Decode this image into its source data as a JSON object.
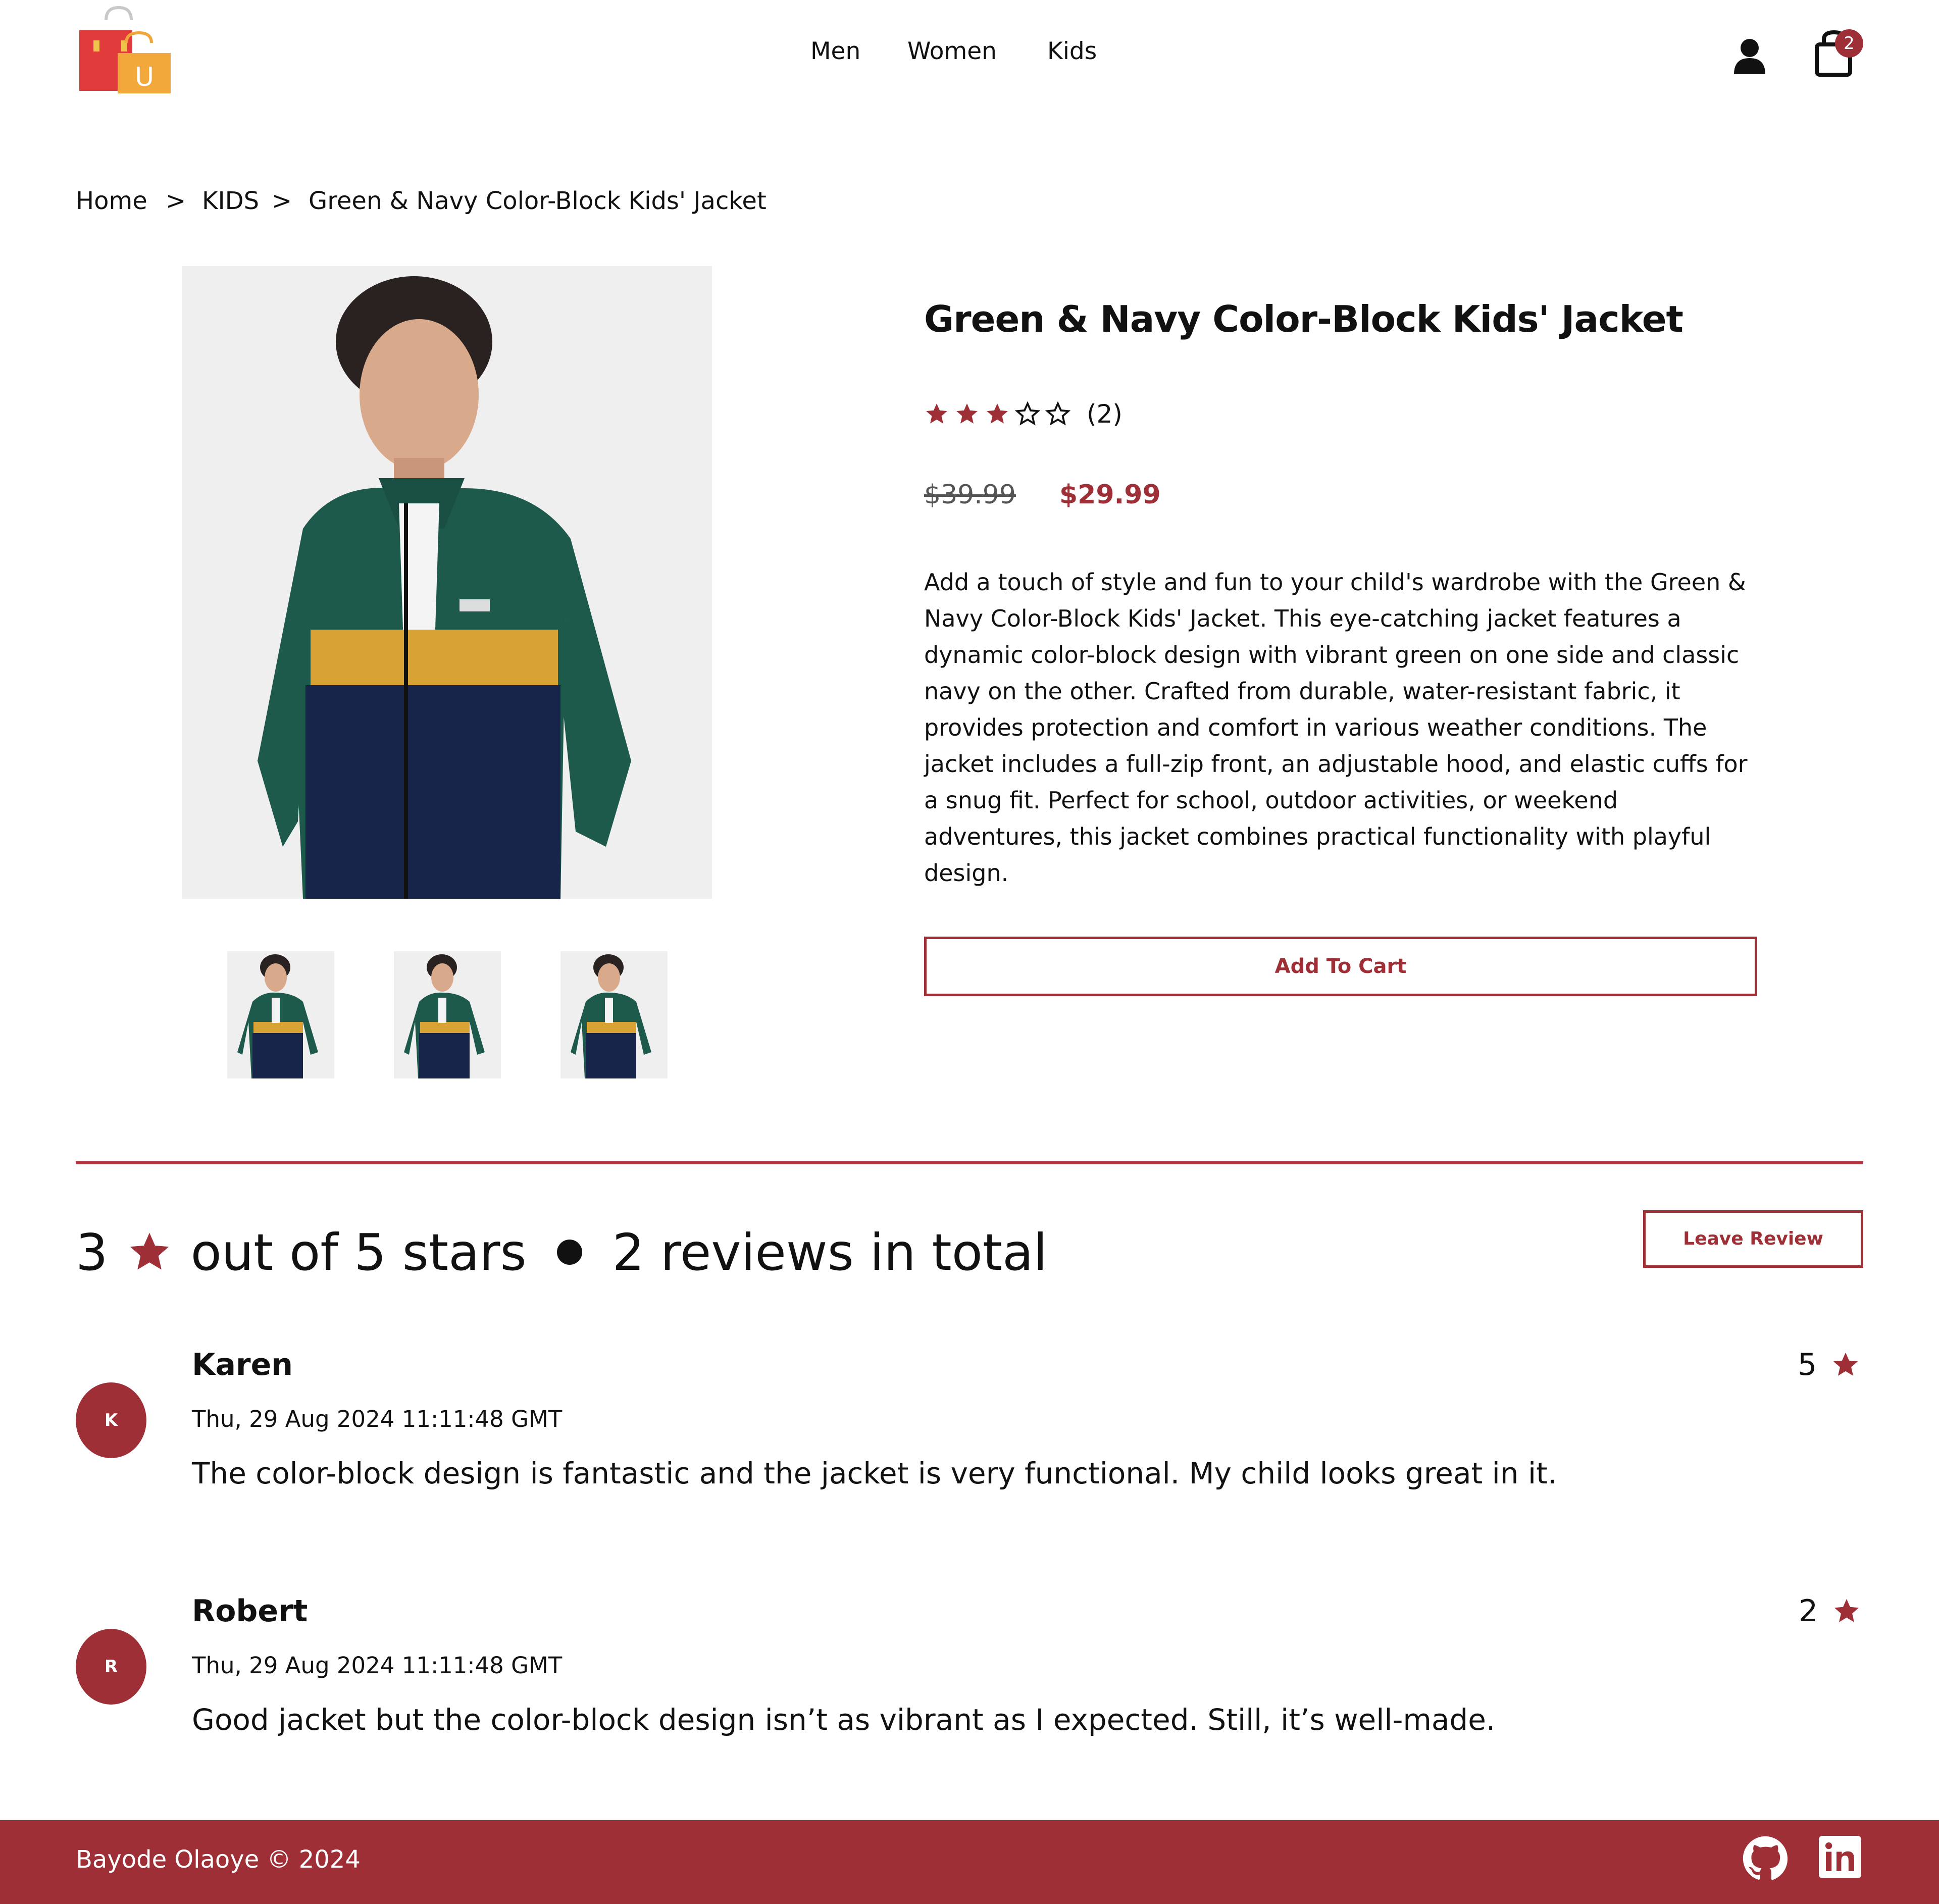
{
  "header": {
    "nav": [
      "Men",
      "Women",
      "Kids"
    ],
    "cart_count": "2",
    "logo_letter": "U"
  },
  "breadcrumb": {
    "home": "Home",
    "sep": ">",
    "category": "KIDS",
    "current": "Green & Navy Color-Block Kids' Jacket"
  },
  "product": {
    "title": "Green & Navy Color-Block Kids' Jacket",
    "rating": 3,
    "rating_max": 5,
    "review_count_label": "(2)",
    "old_price": "$39.99",
    "new_price": "$29.99",
    "description": "Add a touch of style and fun to your child's wardrobe with the Green & Navy Color-Block Kids' Jacket. This eye-catching jacket features a dynamic color-block design with vibrant green on one side and classic navy on the other. Crafted from durable, water-resistant fabric, it provides protection and comfort in various weather conditions. The jacket includes a full-zip front, an adjustable hood, and elastic cuffs for a snug fit. Perfect for school, outdoor activities, or weekend adventures, this jacket combines practical functionality with playful design.",
    "add_to_cart_label": "Add To Cart",
    "thumbnail_count": 3
  },
  "reviews_summary": {
    "score": "3",
    "out_of": "out of 5 stars",
    "total": "2 reviews in total",
    "leave_review_label": "Leave Review"
  },
  "reviews": [
    {
      "initial": "K",
      "name": "Karen",
      "date": "Thu, 29 Aug 2024 11:11:48 GMT",
      "text": "The color-block design is fantastic and the jacket is very functional. My child looks great in it.",
      "score": "5"
    },
    {
      "initial": "R",
      "name": "Robert",
      "date": "Thu, 29 Aug 2024 11:11:48 GMT",
      "text": "Good jacket but the color-block design isn’t as vibrant as I expected. Still, it’s well-made.",
      "score": "2"
    }
  ],
  "footer": {
    "copyright": "Bayode Olaoye © 2024"
  },
  "colors": {
    "accent": "#9f2f36",
    "jacket_green": "#1e5a4c",
    "jacket_navy": "#17254a",
    "jacket_mustard": "#d8a334"
  },
  "icons": [
    "shopping-bag-logo-icon",
    "user-icon",
    "cart-bag-icon",
    "star-icon",
    "github-icon",
    "linkedin-icon"
  ]
}
